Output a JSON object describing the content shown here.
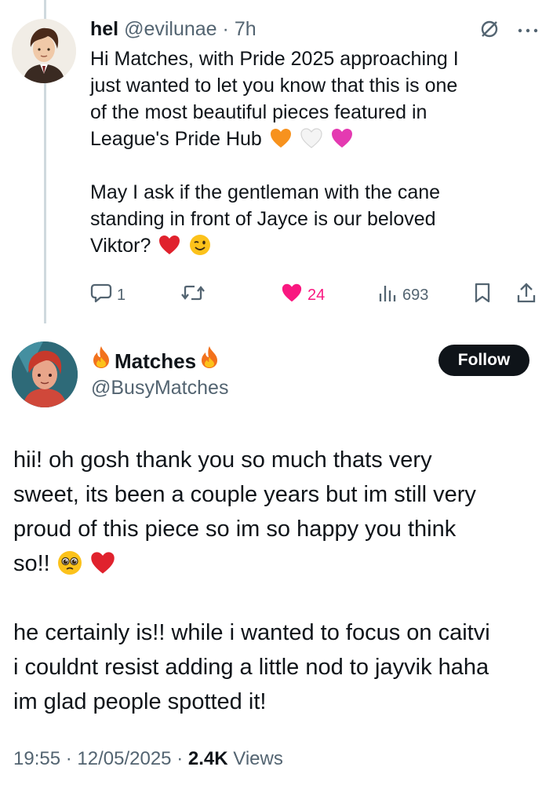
{
  "tweet": {
    "author_name": "hel",
    "author_handle": "@evilunae",
    "separator": "·",
    "time": "7h",
    "paragraph1_line1": "Hi Matches, with Pride 2025 approaching I",
    "paragraph1_line2": "just wanted to let you know that this is one",
    "paragraph1_line3": "of the most beautiful pieces featured in",
    "paragraph1_line4": "League's Pride Hub",
    "paragraph2_line1": "May I ask if the gentleman with the cane",
    "paragraph2_line2": "standing in front of Jayce is our beloved",
    "paragraph2_line3": "Viktor?",
    "reply_count": "1",
    "like_count": "24",
    "view_count": "693",
    "icons": [
      "mute-icon",
      "more-icon",
      "reply-icon",
      "retweet-icon",
      "like-icon",
      "views-icon",
      "bookmark-icon",
      "share-icon"
    ]
  },
  "reply": {
    "author_name": "Matches",
    "author_handle": "@BusyMatches",
    "follow_label": "Follow",
    "paragraph1_line1": "hii! oh gosh thank you so much thats very",
    "paragraph1_line2": "sweet, its been a couple years but im still very",
    "paragraph1_line3": "proud of this piece so im so happy you think",
    "paragraph1_line4": "so!!",
    "paragraph2_line1": "he certainly is!! while i wanted to focus on caitvi",
    "paragraph2_line2": "i couldnt resist adding a little nod to jayvik haha",
    "paragraph2_line3": "im glad people spotted it!",
    "time": "19:55",
    "separator": "·",
    "date": "12/05/2025",
    "views_count": "2.4K",
    "views_label": "Views"
  },
  "colors": {
    "text": "#0f1419",
    "secondary": "#536471",
    "like": "#f91880",
    "follow_bg": "#0f1419",
    "thread_line": "#cfd9de"
  }
}
